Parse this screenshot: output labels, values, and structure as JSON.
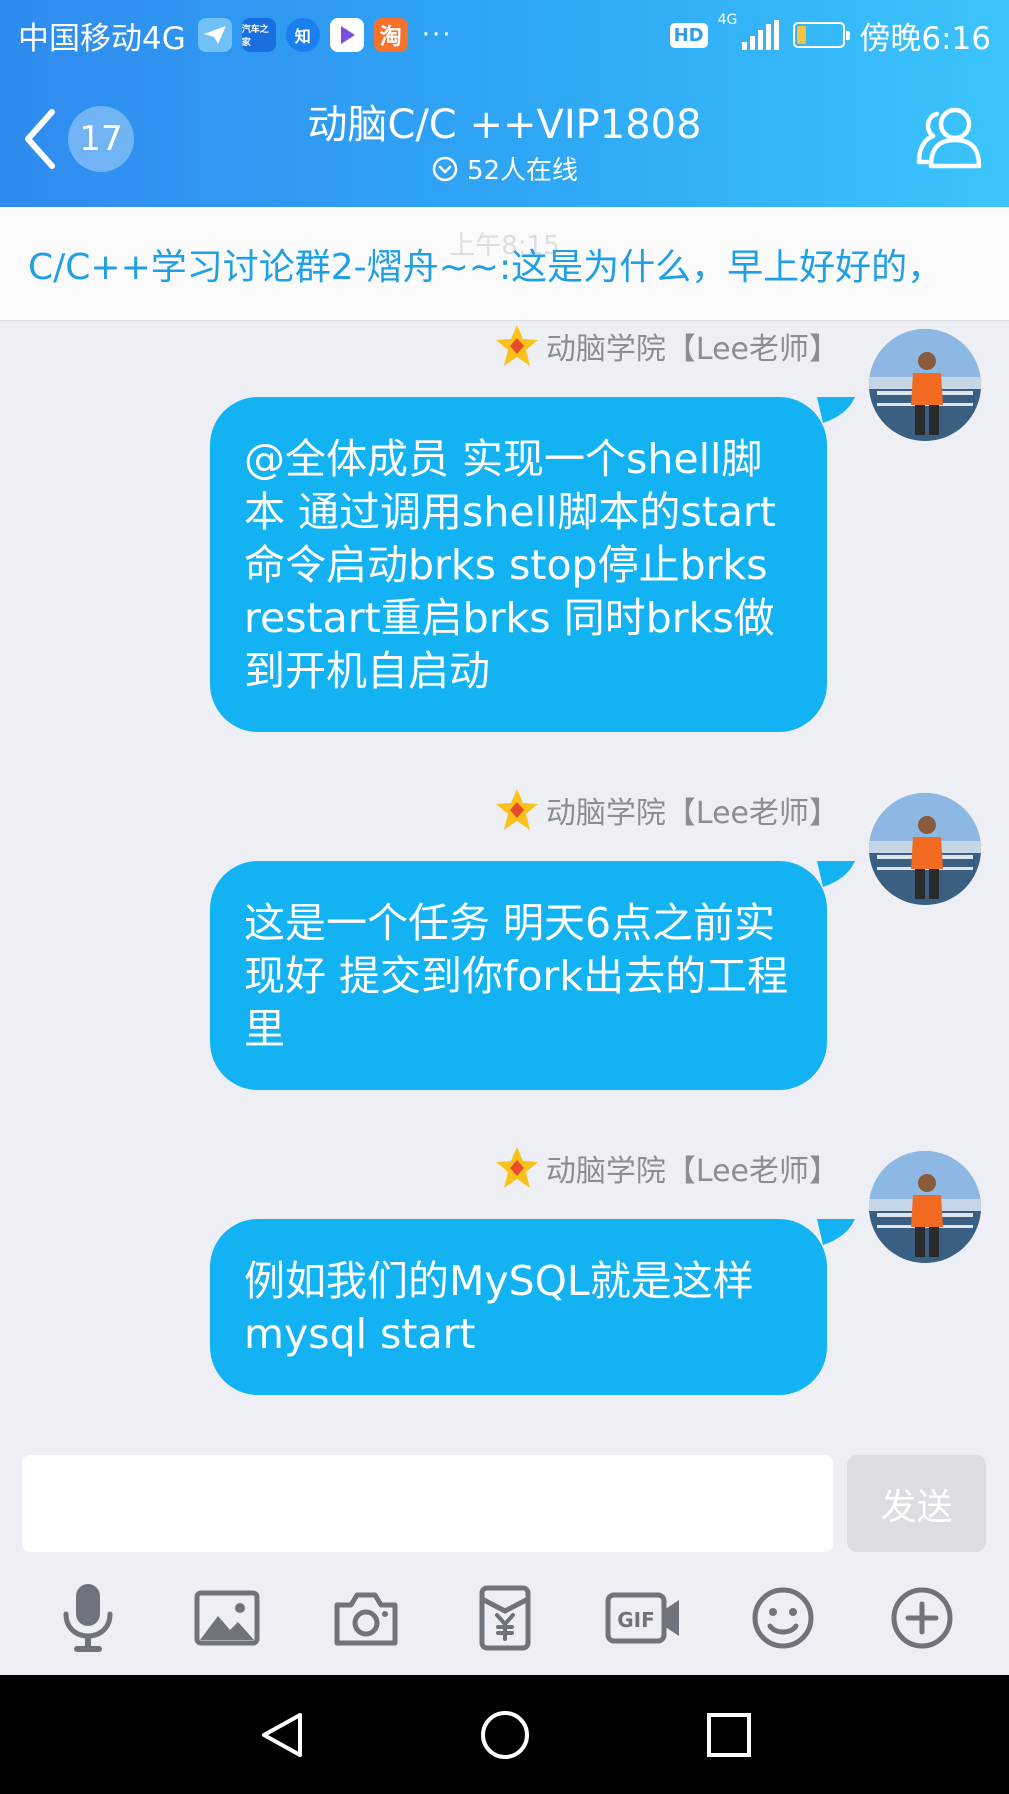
{
  "status_bar": {
    "carrier": "中国移动4G",
    "apps": [
      {
        "name": "message-app-icon",
        "label": "",
        "color": "#6fc1f7"
      },
      {
        "name": "autohome-app-icon",
        "label": "汽车之家",
        "color": "#1a6fe0"
      },
      {
        "name": "zhihu-app-icon",
        "label": "知",
        "color": "#1b7ff0"
      },
      {
        "name": "video-app-icon",
        "label": "",
        "color": "#ffffff"
      },
      {
        "name": "taobao-app-icon",
        "label": "淘",
        "color": "#f4722b"
      }
    ],
    "more": "···",
    "hd_badge": "HD",
    "network": "4G",
    "battery_level": 0.2,
    "time": "傍晚6:16"
  },
  "header": {
    "unread_count": "17",
    "title": "动脑C/C ++VIP1808",
    "online": "52人在线"
  },
  "notice": {
    "time": "上午8:15",
    "text": "C/C++学习讨论群2-熠舟~~:这是为什么，早上好好的，"
  },
  "messages": [
    {
      "sender": "动脑学院【Lee老师】",
      "text": "@全体成员 实现一个shell脚本 通过调用shell脚本的start命令启动brks  stop停止brks  restart重启brks  同时brks做到开机自启动"
    },
    {
      "sender": "动脑学院【Lee老师】",
      "text": "这是一个任务  明天6点之前实现好  提交到你fork出去的工程里"
    },
    {
      "sender": "动脑学院【Lee老师】",
      "text": "例如我们的MySQL就是这样 mysql start"
    }
  ],
  "composer": {
    "placeholder": "",
    "send_label": "发送",
    "tools": [
      "microphone-icon",
      "image-icon",
      "camera-icon",
      "red-packet-icon",
      "gif-icon",
      "emoji-icon",
      "plus-icon"
    ]
  },
  "colors": {
    "header_start": "#2f8bef",
    "header_end": "#3bc4fb",
    "bubble": "#13b2f2",
    "notice_text": "#1f9fe6"
  }
}
